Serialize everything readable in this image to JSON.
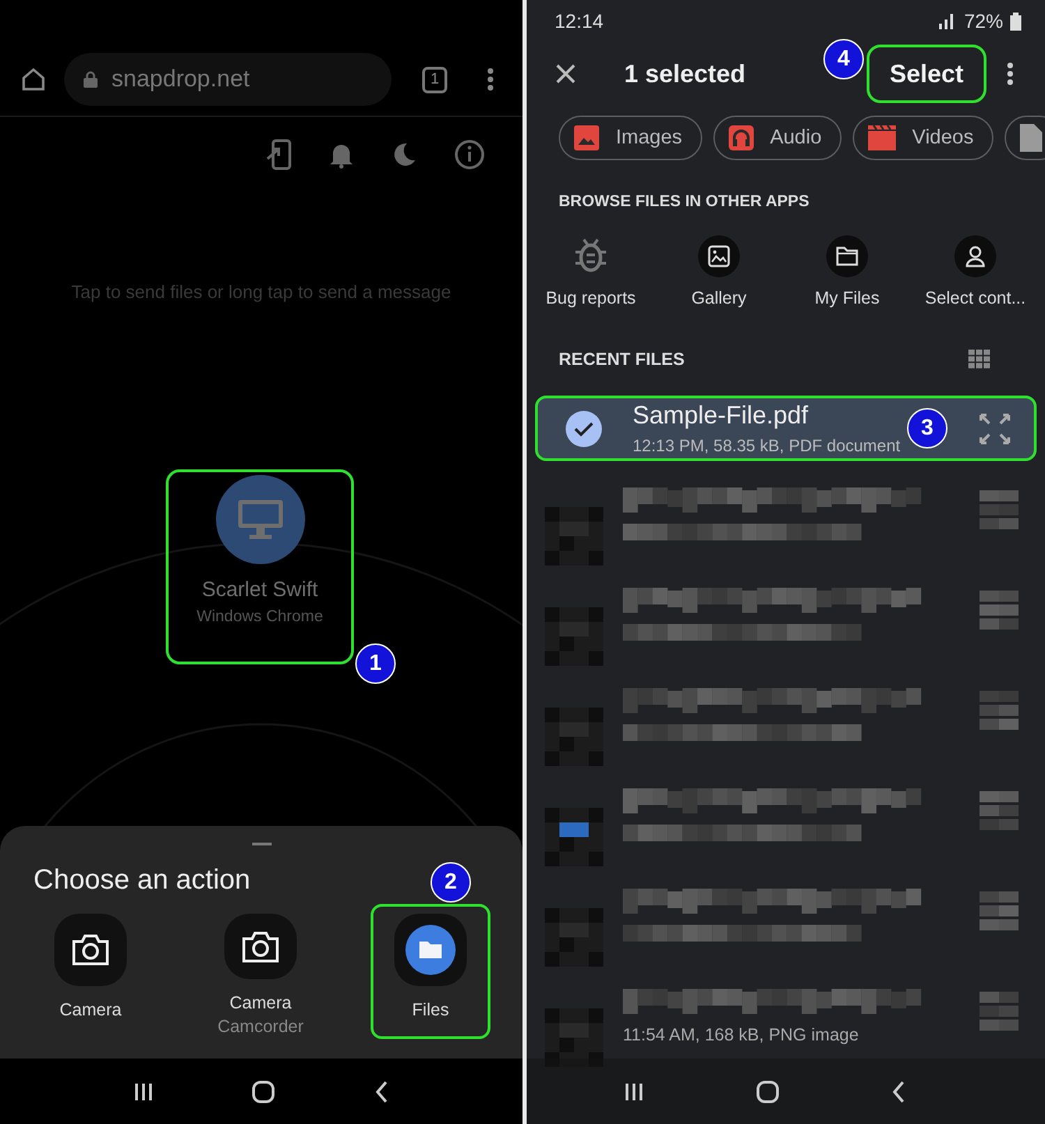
{
  "browser": {
    "url": "snapdrop.net",
    "tab_count": "1"
  },
  "snapdrop": {
    "hint": "Tap to send files or long tap to send a message",
    "peer": {
      "name": "Scarlet Swift",
      "device": "Windows Chrome",
      "callout": "1"
    }
  },
  "action_sheet": {
    "title": "Choose an action",
    "actions": [
      {
        "kind": "camera",
        "label": "Camera"
      },
      {
        "kind": "camera",
        "label": "Camera",
        "sublabel": "Camcorder"
      },
      {
        "kind": "files",
        "label": "Files",
        "callout": "2"
      }
    ]
  },
  "status_bar": {
    "time": "12:14",
    "battery": "72%"
  },
  "picker": {
    "title": "1 selected",
    "action": {
      "label": "Select",
      "callout": "4"
    },
    "chips": [
      {
        "kind": "images",
        "label": "Images"
      },
      {
        "kind": "audio",
        "label": "Audio"
      },
      {
        "kind": "videos",
        "label": "Videos"
      },
      {
        "kind": "documents"
      }
    ],
    "browse_title": "BROWSE FILES IN OTHER APPS",
    "apps": [
      {
        "kind": "bug",
        "label": "Bug reports"
      },
      {
        "kind": "gallery",
        "label": "Gallery"
      },
      {
        "kind": "folder",
        "label": "My Files"
      },
      {
        "kind": "contact",
        "label": "Select cont..."
      }
    ],
    "recent_title": "RECENT FILES",
    "files": [
      {
        "kind": "file",
        "name": "Sample-File.pdf",
        "meta": "12:13 PM, 58.35 kB, PDF document",
        "selected": true,
        "callout": "3"
      },
      {
        "kind": "redacted",
        "selected": false
      },
      {
        "kind": "redacted",
        "selected": false
      },
      {
        "kind": "redacted",
        "selected": false
      },
      {
        "kind": "redacted",
        "selected": false
      },
      {
        "kind": "redacted",
        "selected": false
      },
      {
        "kind": "redacted",
        "meta": "11:54 AM, 168 kB, PNG image",
        "selected": false
      }
    ]
  }
}
